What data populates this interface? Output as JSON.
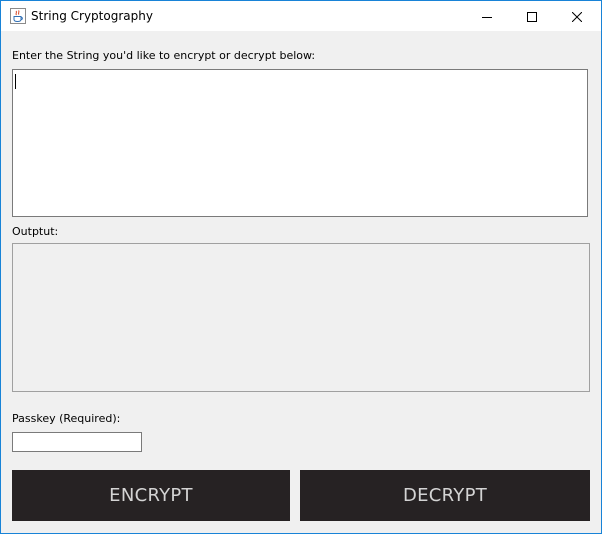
{
  "window": {
    "title": "String Cryptography",
    "icon": "java-cup-icon",
    "controls": [
      "minimize-icon",
      "maximize-icon",
      "close-icon"
    ]
  },
  "form": {
    "input_label": "Enter the String you'd like to encrypt or decrypt below:",
    "input_value": "",
    "output_label": "Outptut:",
    "output_value": "",
    "passkey_label": "Passkey (Required):",
    "passkey_value": ""
  },
  "actions": {
    "encrypt_label": "ENCRYPT",
    "decrypt_label": "DECRYPT"
  },
  "colors": {
    "button_bg": "#262223",
    "button_text": "#d4d4d4",
    "window_bg": "#f0f0f0",
    "border_accent": "#1883d7"
  }
}
